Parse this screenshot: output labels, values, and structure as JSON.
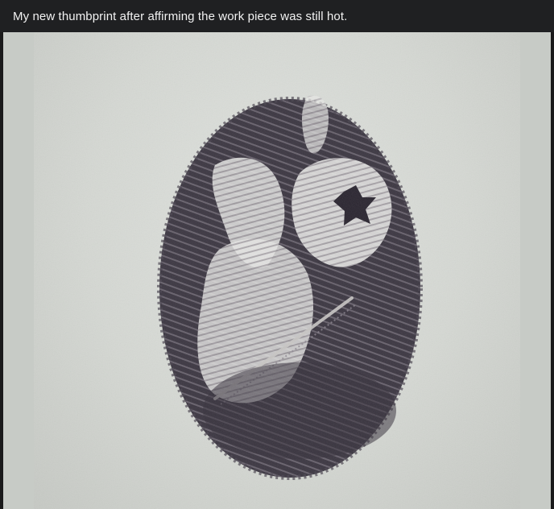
{
  "post": {
    "title": "My new thumbprint after affirming the work piece was still hot."
  },
  "media": {
    "kind": "photo",
    "colors": {
      "paper": "#d7dad5",
      "ink": "#3a3540",
      "ink_light": "#6b6570",
      "side_panel": "#c7cbc6"
    }
  }
}
